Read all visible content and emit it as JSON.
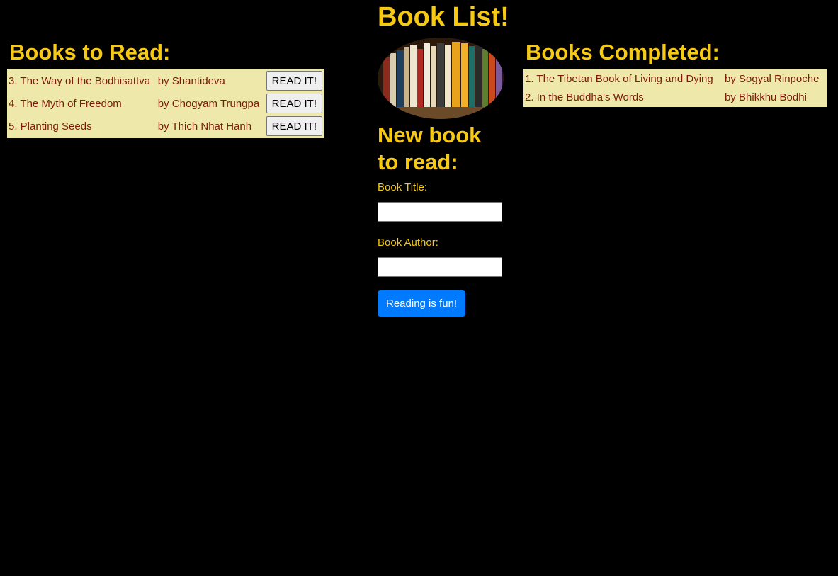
{
  "header": {
    "title": "Book List!"
  },
  "to_read": {
    "heading": "Books to Read:",
    "button_label": "READ IT!",
    "rows": [
      {
        "title": "3. The Way of the Bodhisattva",
        "author": "by Shantideva"
      },
      {
        "title": "4. The Myth of Freedom",
        "author": "by Chogyam Trungpa"
      },
      {
        "title": "5. Planting Seeds",
        "author": "by Thich Nhat Hanh"
      }
    ]
  },
  "completed": {
    "heading": "Books Completed:",
    "rows": [
      {
        "title": "1. The Tibetan Book of Living and Dying",
        "author": "by Sogyal Rinpoche"
      },
      {
        "title": "2. In the Buddha's Words",
        "author": "by Bhikkhu Bodhi"
      }
    ]
  },
  "form": {
    "heading": "New book to read:",
    "title_label": "Book Title:",
    "title_value": "",
    "author_label": "Book Author:",
    "author_value": "",
    "submit_label": "Reading is fun!"
  },
  "colors": {
    "background": "#000000",
    "heading": "#f6c915",
    "table_background": "#eee8aa",
    "table_text": "#7a1c06",
    "primary_button": "#007bff"
  }
}
